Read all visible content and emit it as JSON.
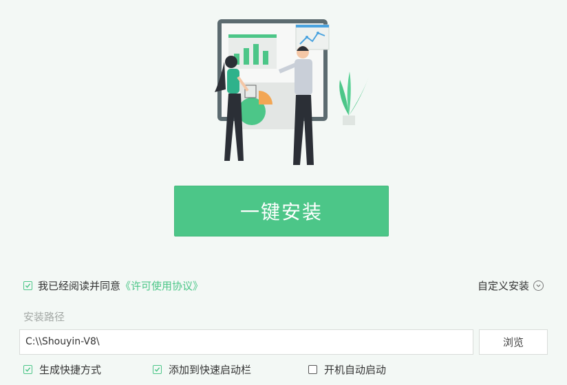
{
  "hero": {
    "illustration": "two-people-presenting-charts-icon"
  },
  "install_button": {
    "label": "一键安装"
  },
  "agreement": {
    "checked": true,
    "text": "我已经阅读并同意",
    "link": "《许可使用协议》"
  },
  "custom_install": {
    "label": "自定义安装",
    "icon": "chevron-down-circle-icon"
  },
  "install_path": {
    "label": "安装路径",
    "value": "C:\\\\Shouyin-V8\\",
    "browse_label": "浏览"
  },
  "options": [
    {
      "label": "生成快捷方式",
      "checked": true
    },
    {
      "label": "添加到快速启动栏",
      "checked": true
    },
    {
      "label": "开机自动启动",
      "checked": false
    }
  ],
  "colors": {
    "accent": "#4cc688",
    "background": "#f3f8f5"
  }
}
